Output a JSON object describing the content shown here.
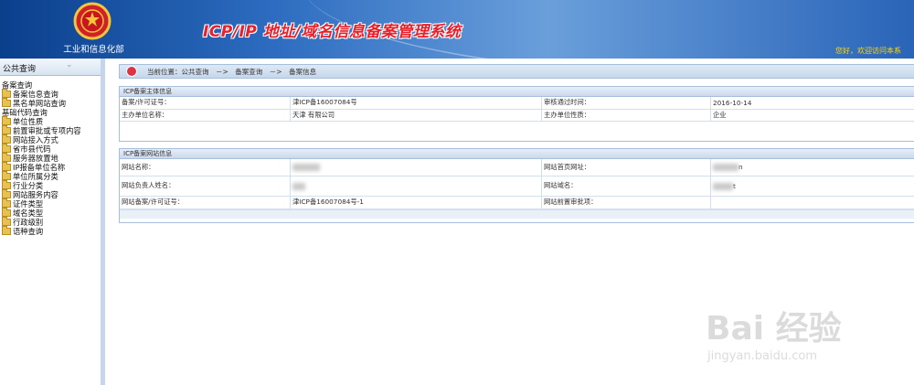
{
  "header": {
    "ministry": "工业和信息化部",
    "system_title": "ICP/IP 地址/域名信息备案管理系统",
    "welcome": "您好，欢迎访问本系"
  },
  "sidebar": {
    "title": "公共查询",
    "collapse_icon": "double-chevron-down-icon",
    "groups": [
      {
        "label": "备案查询",
        "items": [
          "备案信息查询",
          "黑名单网站查询"
        ]
      },
      {
        "label": "基础代码查询",
        "items": [
          "单位性质",
          "前置审批或专项内容",
          "网站接入方式",
          "省市县代码",
          "服务器放置地",
          "IP报备单位名称",
          "单位所属分类",
          "行业分类",
          "网站服务内容",
          "证件类型",
          "域名类型",
          "行政级别",
          "语种查询"
        ]
      }
    ]
  },
  "breadcrumb": {
    "icon": "home-icon",
    "text": "当前位置：公共查询　－>　备案查询　－>　备案信息"
  },
  "entity_panel": {
    "title": "ICP备案主体信息",
    "rows": [
      [
        "备案/许可证号：",
        "津ICP备16007084号",
        "审核通过时间：",
        "2016-10-14"
      ],
      [
        "主办单位名称：",
        "天津          有限公司",
        "主办单位性质：",
        "企业"
      ]
    ]
  },
  "website_panel": {
    "title": "ICP备案网站信息",
    "rows": [
      [
        "网站名称：",
        "",
        "网站首页网址：",
        "n"
      ],
      [
        "网站负责人姓名：",
        "",
        "网站域名：",
        "t"
      ],
      [
        "网站备案/许可证号：",
        "津ICP备16007084号-1",
        "网站前置审批项：",
        ""
      ]
    ]
  },
  "watermark": {
    "main": "Bai 经验",
    "sub": "jingyan.baidu.com"
  }
}
